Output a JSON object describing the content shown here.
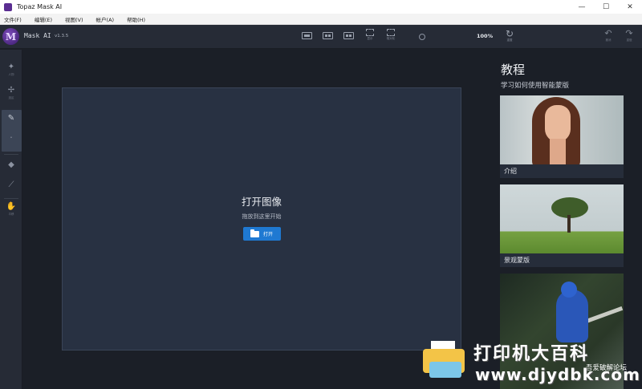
{
  "window": {
    "title": "Topaz Mask AI",
    "minimize_glyph": "—",
    "maximize_glyph": "☐",
    "close_glyph": "✕"
  },
  "menu": [
    "文件(F)",
    "编辑(E)",
    "视图(V)",
    "帐户(A)",
    "帮助(H)"
  ],
  "toolbar": {
    "app_name": "Mask AI",
    "version": "v1.3.5",
    "crop_label": "显示",
    "fit_label": "相对化",
    "zoom": "100%",
    "refresh_label": "重置",
    "undo_label": "撤消",
    "redo_label": "重做"
  },
  "sidebar": {
    "tools": [
      {
        "icon": "person-icon",
        "glyph": "✦",
        "label": "人物"
      },
      {
        "icon": "select-icon",
        "glyph": "✢",
        "label": "选区"
      },
      {
        "icon": "brush-icon",
        "glyph": "✎",
        "label": ""
      },
      {
        "icon": "fill-icon",
        "glyph": "◆",
        "label": ""
      },
      {
        "icon": "dropper-icon",
        "glyph": "⟋",
        "label": ""
      },
      {
        "icon": "hand-icon",
        "glyph": "✋",
        "label": "平移"
      }
    ]
  },
  "dropzone": {
    "title": "打开图像",
    "subtitle": "拖放到这里开始",
    "open_label": "打开"
  },
  "tutorial": {
    "title": "教程",
    "subtitle": "学习如何使用智能蒙版",
    "cards": [
      {
        "caption": "介绍"
      },
      {
        "caption": "景观蒙版"
      },
      {
        "caption": ""
      }
    ]
  },
  "watermark": {
    "title": "打印机大百科",
    "url": "www.djydbk.com",
    "forum": "吾爱破解论坛"
  }
}
